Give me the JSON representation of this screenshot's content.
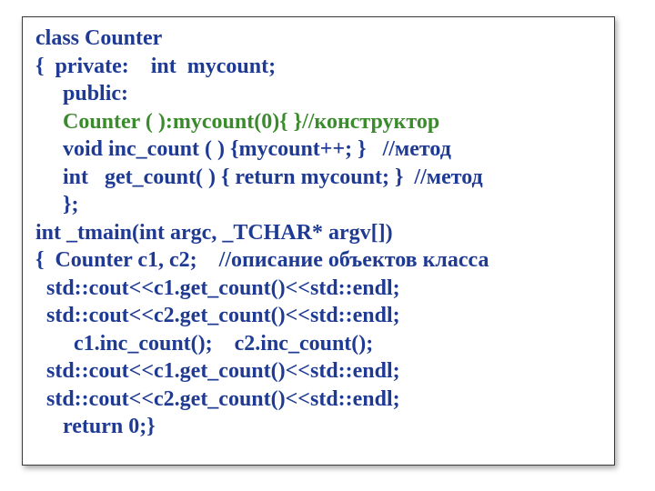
{
  "code": {
    "l1": "class Counter",
    "l2": "{  private:    int  mycount;",
    "l3": "     public:",
    "l4a": "     ",
    "l4b": "Counter ( ):mycount(0){ }//конструктор",
    "l5": "     void inc_count ( ) {mycount++; }   //метод",
    "l6": "     int   get_count( ) { return mycount; }  //метод",
    "l7": "     };",
    "l8": "int _tmain(int argc, _TCHAR* argv[])",
    "l9": "{  Counter c1, c2;    //описание объектов класса",
    "l10": "  std::cout<<c1.get_count()<<std::endl;",
    "l11": "  std::cout<<c2.get_count()<<std::endl;",
    "l12": "       c1.inc_count();    c2.inc_count();",
    "l13": "  std::cout<<c1.get_count()<<std::endl;",
    "l14": "  std::cout<<c2.get_count()<<std::endl;",
    "l15": "     return 0;}"
  }
}
